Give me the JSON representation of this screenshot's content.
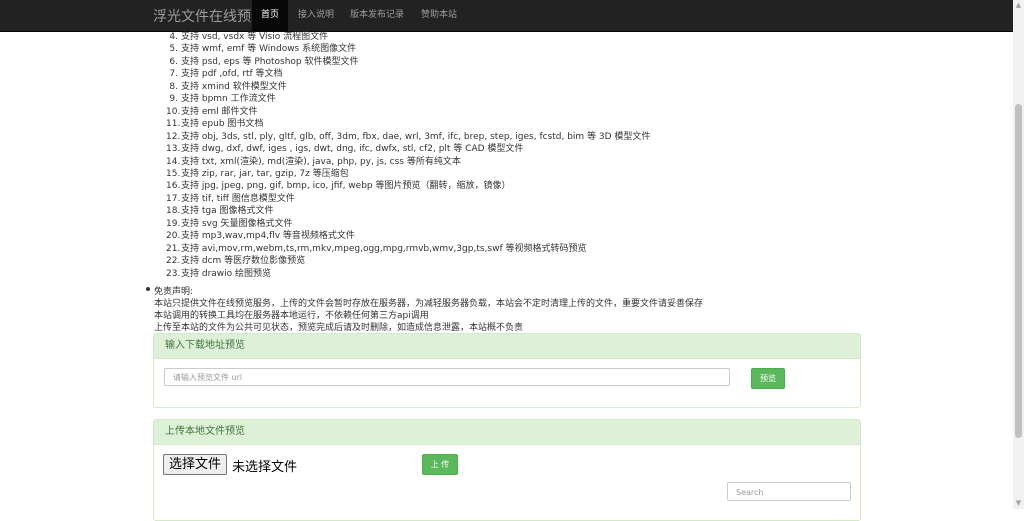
{
  "navbar": {
    "brand": "浮光文件在线预览",
    "items": [
      {
        "label": "首页",
        "active": true
      },
      {
        "label": "接入说明",
        "active": false
      },
      {
        "label": "版本发布记录",
        "active": false
      },
      {
        "label": "赞助本站",
        "active": false
      }
    ]
  },
  "supported_list": [
    {
      "num": "4.",
      "text": "支持 vsd, vsdx 等 Visio 流程图文件"
    },
    {
      "num": "5.",
      "text": "支持 wmf, emf 等 Windows 系统图像文件"
    },
    {
      "num": "6.",
      "text": "支持 psd, eps 等 Photoshop 软件模型文件"
    },
    {
      "num": "7.",
      "text": "支持 pdf ,ofd, rtf 等文档"
    },
    {
      "num": "8.",
      "text": "支持 xmind 软件模型文件"
    },
    {
      "num": "9.",
      "text": "支持 bpmn 工作流文件"
    },
    {
      "num": "10.",
      "text": "支持 eml 邮件文件"
    },
    {
      "num": "11.",
      "text": "支持 epub 图书文档"
    },
    {
      "num": "12.",
      "text": "支持 obj, 3ds, stl, ply, gltf, glb, off, 3dm, fbx, dae, wrl, 3mf, ifc, brep, step, iges, fcstd, bim 等 3D 模型文件"
    },
    {
      "num": "13.",
      "text": "支持 dwg, dxf, dwf, iges , igs, dwt, dng, ifc, dwfx, stl, cf2, plt 等 CAD 模型文件"
    },
    {
      "num": "14.",
      "text": "支持 txt, xml(渲染), md(渲染), java, php, py, js, css 等所有纯文本"
    },
    {
      "num": "15.",
      "text": "支持 zip, rar, jar, tar, gzip, 7z 等压缩包"
    },
    {
      "num": "16.",
      "text": "支持 jpg, jpeg, png, gif, bmp, ico, jfif, webp 等图片预览（翻转，缩放，镜像）"
    },
    {
      "num": "17.",
      "text": "支持 tif, tiff 图信息模型文件"
    },
    {
      "num": "18.",
      "text": "支持 tga 图像格式文件"
    },
    {
      "num": "19.",
      "text": "支持 svg 矢量图像格式文件"
    },
    {
      "num": "20.",
      "text": "支持 mp3,wav,mp4,flv 等音视频格式文件"
    },
    {
      "num": "21.",
      "text": "支持 avi,mov,rm,webm,ts,rm,mkv,mpeg,ogg,mpg,rmvb,wmv,3gp,ts,swf 等视频格式转码预览"
    },
    {
      "num": "22.",
      "text": "支持 dcm 等医疗数位影像预览"
    },
    {
      "num": "23.",
      "text": "支持 drawio 绘图预览"
    }
  ],
  "disclaimer": {
    "title": "免责声明:",
    "lines": [
      "本站只提供文件在线预览服务，上传的文件会暂时存放在服务器，为减轻服务器负载，本站会不定时清理上传的文件，重要文件请妥善保存",
      "本站调用的转换工具均在服务器本地运行，不依赖任何第三方api调用",
      "上传至本站的文件为公共可见状态，预览完成后请及时删除，如造成信息泄露，本站概不负责"
    ]
  },
  "url_panel": {
    "title": "输入下载地址预览",
    "placeholder": "请输入预览文件 url",
    "button": "预览"
  },
  "upload_panel": {
    "title": "上传本地文件预览",
    "choose_button": "选择文件",
    "file_status": "未选择文件",
    "upload_button": "上 传",
    "search_placeholder": "Search"
  }
}
